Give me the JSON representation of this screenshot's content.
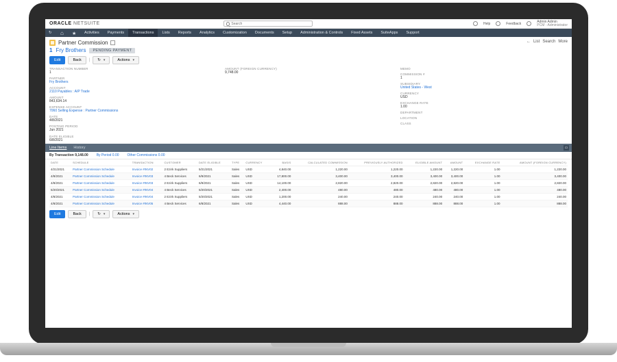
{
  "brand": {
    "oracle": "ORACLE",
    "netsuite": "NETSUITE"
  },
  "search": {
    "placeholder": "Search"
  },
  "topRight": {
    "help": "Help",
    "feedback": "Feedback",
    "role_line1": "Admin Admin",
    "role_line2": "PCM - Administrator"
  },
  "nav": {
    "items": [
      "Activities",
      "Payments",
      "Transactions",
      "Lists",
      "Reports",
      "Analytics",
      "Customization",
      "Documents",
      "Setup",
      "Administration & Controls",
      "Fixed Assets",
      "SuiteApps",
      "Support"
    ],
    "active_index": 2
  },
  "headActions": {
    "back": "←",
    "list": "List",
    "search": "Search",
    "more": "More"
  },
  "page": {
    "title": "Partner Commission",
    "sub_id": "1",
    "sub_name": "Fry Brothers",
    "status": "PENDING PAYMENT"
  },
  "buttons": {
    "edit": "Edit",
    "back": "Back",
    "actions": "Actions"
  },
  "fields": {
    "col1": [
      {
        "lbl": "TRANSACTION NUMBER",
        "val": "1"
      },
      {
        "lbl": "PARTNER",
        "val": "Fry Brothers",
        "link": true
      },
      {
        "lbl": "ACCOUNT",
        "val": "2110 Payables : A/P Trade",
        "link": true
      },
      {
        "lbl": "AMOUNT",
        "val": "843,634.14"
      },
      {
        "lbl": "EXPENSE ACCOUNT",
        "val": "7060 Selling Expense : Partner Commissions",
        "link": true
      },
      {
        "lbl": "DATE",
        "val": "4/8/2021"
      },
      {
        "lbl": "POSTING PERIOD",
        "val": "Jun 2021"
      }
    ],
    "col2": [
      {
        "lbl": "AMOUNT (FOREIGN CURRENCY)",
        "val": "9,748.00"
      }
    ],
    "col3": [
      {
        "lbl": "MEMO",
        "val": ""
      },
      {
        "lbl": "COMMISSION #",
        "val": "1"
      },
      {
        "lbl": "SUBSIDIARY",
        "val": "United States - West",
        "link": true
      },
      {
        "lbl": "CURRENCY",
        "val": "USD"
      },
      {
        "lbl": "EXCHANGE RATE",
        "val": "1.00"
      },
      {
        "lbl": "DEPARTMENT",
        "val": ""
      },
      {
        "lbl": "LOCATION",
        "val": ""
      },
      {
        "lbl": "CLASS",
        "val": ""
      }
    ],
    "date_eligible": {
      "lbl": "DATE ELIGIBLE",
      "val": "6/8/2021"
    }
  },
  "tabBand": {
    "tabs": [
      "Line Items",
      "History"
    ],
    "active_index": 0
  },
  "subTabs": {
    "items": [
      {
        "label": "By Transaction",
        "amount": "9,148.00"
      },
      {
        "label": "By Period",
        "amount": "0.00"
      },
      {
        "label": "Other Commissions",
        "amount": "0.00"
      }
    ],
    "active_index": 0
  },
  "columns": [
    "DATE",
    "SCHEDULE",
    "TRANSACTION",
    "CUSTOMER",
    "DATE ELIGIBLE",
    "TYPE",
    "CURRENCY",
    "BASIS",
    "CALCULATED COMMISSION",
    "PREVIOUSLY AUTHORIZED",
    "ELIGIBLE AMOUNT",
    "AMOUNT",
    "EXCHANGE RATE",
    "AMOUNT (FOREIGN CURRENCY)"
  ],
  "rows": [
    {
      "date": "4/21/2021",
      "sched": "Partner Commission Schedule",
      "txn": "Invoice #INV02",
      "cust": "2 Ezirk Suppliers",
      "elig": "5/21/2021",
      "type": "Sales",
      "curr": "USD",
      "basis": "4,840.00",
      "calc": "1,220.00",
      "prev": "1,220.00",
      "eligamt": "1,220.00",
      "amt": "1,220.00",
      "rate": "1.00",
      "amtf": "1,220.00"
    },
    {
      "date": "4/8/2021",
      "sched": "Partner Commission Schedule",
      "txn": "Invoice #INV03",
      "cust": "4 Beck Services",
      "elig": "6/9/2021",
      "type": "Sales",
      "curr": "USD",
      "basis": "17,800.00",
      "calc": "3,400.00",
      "prev": "3,400.00",
      "eligamt": "3,400.00",
      "amt": "3,400.00",
      "rate": "1.00",
      "amtf": "3,400.00"
    },
    {
      "date": "4/8/2021",
      "sched": "Partner Commission Schedule",
      "txn": "Invoice #INV03",
      "cust": "2 Ezirk Suppliers",
      "elig": "6/9/2021",
      "type": "Sales",
      "curr": "USD",
      "basis": "14,100.00",
      "calc": "2,820.00",
      "prev": "2,820.00",
      "eligamt": "2,820.00",
      "amt": "2,820.00",
      "rate": "1.00",
      "amtf": "2,820.00"
    },
    {
      "date": "5/20/2021",
      "sched": "Partner Commission Schedule",
      "txn": "Invoice #INV04",
      "cust": "4 Beck Services",
      "elig": "5/20/2021",
      "type": "Sales",
      "curr": "USD",
      "basis": "2,400.00",
      "calc": "480.00",
      "prev": "480.00",
      "eligamt": "480.00",
      "amt": "480.00",
      "rate": "1.00",
      "amtf": "480.00"
    },
    {
      "date": "4/8/2021",
      "sched": "Partner Commission Schedule",
      "txn": "Invoice #INV04",
      "cust": "2 Ezirk Suppliers",
      "elig": "5/20/2021",
      "type": "Sales",
      "curr": "USD",
      "basis": "1,200.00",
      "calc": "240.00",
      "prev": "240.00",
      "eligamt": "240.00",
      "amt": "240.00",
      "rate": "1.00",
      "amtf": "240.00"
    },
    {
      "date": "4/8/2021",
      "sched": "Partner Commission Schedule",
      "txn": "Invoice #INV05",
      "cust": "4 Beck Services",
      "elig": "6/8/2021",
      "type": "Sales",
      "curr": "USD",
      "basis": "4,440.00",
      "calc": "888.00",
      "prev": "888.00",
      "eligamt": "888.00",
      "amt": "888.00",
      "rate": "1.00",
      "amtf": "888.00"
    }
  ]
}
